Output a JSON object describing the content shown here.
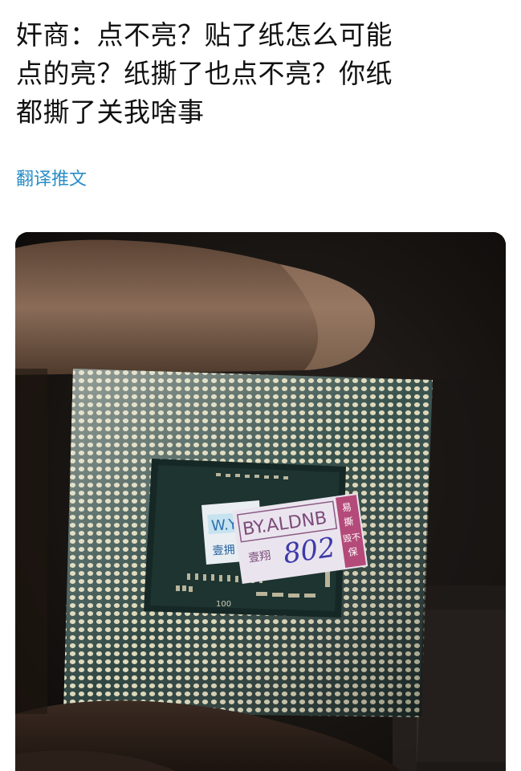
{
  "tweet": {
    "text_lines": [
      "奸商：点不亮？贴了纸怎么可能",
      "点的亮？纸撕了也点不亮？你纸",
      "都撕了关我啥事"
    ],
    "translate_label": "翻译推文"
  },
  "photo": {
    "sticker_back": {
      "line1": "W.Y",
      "line2": "壹拥"
    },
    "sticker_front": {
      "brand": "BY.ALDNB",
      "stamp_cn": "壹翔",
      "handwritten": "802",
      "side_cn_1": "易",
      "side_cn_2": "撕",
      "side_cn_3": "毁不",
      "side_cn_4": "保"
    },
    "pcb_marking": "100"
  }
}
